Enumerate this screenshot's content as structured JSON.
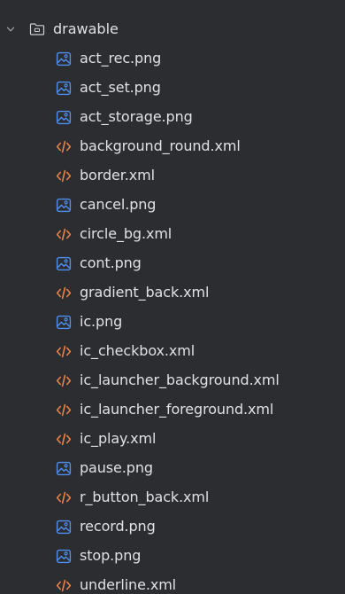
{
  "folder": {
    "name": "drawable",
    "expanded": true,
    "chevron_icon": "chevron-down-icon",
    "icon": "folder-icon"
  },
  "files": [
    {
      "name": "act_rec.png",
      "type": "image",
      "icon": "image-file-icon"
    },
    {
      "name": "act_set.png",
      "type": "image",
      "icon": "image-file-icon"
    },
    {
      "name": "act_storage.png",
      "type": "image",
      "icon": "image-file-icon"
    },
    {
      "name": "background_round.xml",
      "type": "xml",
      "icon": "xml-file-icon"
    },
    {
      "name": "border.xml",
      "type": "xml",
      "icon": "xml-file-icon"
    },
    {
      "name": "cancel.png",
      "type": "image",
      "icon": "image-file-icon"
    },
    {
      "name": "circle_bg.xml",
      "type": "xml",
      "icon": "xml-file-icon"
    },
    {
      "name": "cont.png",
      "type": "image",
      "icon": "image-file-icon"
    },
    {
      "name": "gradient_back.xml",
      "type": "xml",
      "icon": "xml-file-icon"
    },
    {
      "name": "ic.png",
      "type": "image",
      "icon": "image-file-icon"
    },
    {
      "name": "ic_checkbox.xml",
      "type": "xml",
      "icon": "xml-file-icon"
    },
    {
      "name": "ic_launcher_background.xml",
      "type": "xml",
      "icon": "xml-file-icon"
    },
    {
      "name": "ic_launcher_foreground.xml",
      "type": "xml",
      "icon": "xml-file-icon"
    },
    {
      "name": "ic_play.xml",
      "type": "xml",
      "icon": "xml-file-icon"
    },
    {
      "name": "pause.png",
      "type": "image",
      "icon": "image-file-icon"
    },
    {
      "name": "r_button_back.xml",
      "type": "xml",
      "icon": "xml-file-icon"
    },
    {
      "name": "record.png",
      "type": "image",
      "icon": "image-file-icon"
    },
    {
      "name": "stop.png",
      "type": "image",
      "icon": "image-file-icon"
    },
    {
      "name": "underline.xml",
      "type": "xml",
      "icon": "xml-file-icon"
    }
  ],
  "colors": {
    "background": "#2b2d30",
    "text": "#dfe1e5",
    "image_icon": "#4f8ff0",
    "xml_icon": "#e8834a",
    "folder_icon": "#ced0d6",
    "chevron": "#9da0a8"
  }
}
